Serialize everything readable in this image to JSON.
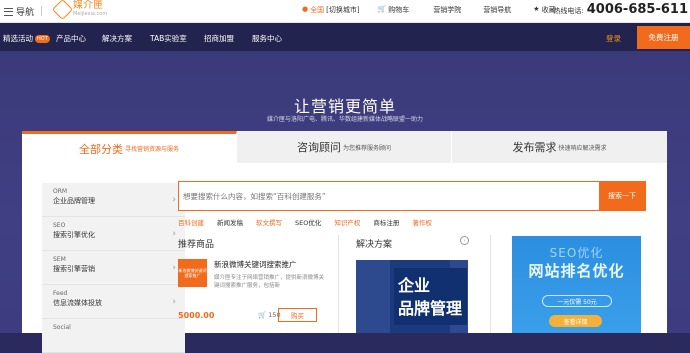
{
  "topbar": {
    "nav_label": "导航",
    "logo_text": "媒介匣",
    "logo_sub": "Meijiexia.com",
    "location": "全国",
    "switch_city": "[切换城市]",
    "cart": "购物车",
    "academy": "营销学院",
    "nav_guide": "营销导航",
    "favorite": "收藏",
    "hotline_label": "热线电话:",
    "hotline_number": "4006-685-611"
  },
  "mainnav": {
    "items": [
      "精选活动",
      "产品中心",
      "解决方案",
      "TAB实验室",
      "招商加盟",
      "服务中心"
    ],
    "hot_badge": "HOT",
    "login": "登录",
    "register": "免费注册"
  },
  "hero": {
    "title": "让营销更简单",
    "subtitle": "媒介匣与洛阳广电、腾讯、华数组建新媒体战略联盟一助力"
  },
  "tabs": [
    {
      "main": "全部分类",
      "sub": "寻找营销资源与服务"
    },
    {
      "main": "咨询顾问",
      "sub": "为您推荐服务顾问"
    },
    {
      "main": "发布需求",
      "sub": "快速响应解决需求"
    }
  ],
  "sidebar": {
    "items": [
      {
        "en": "ORM",
        "cn": "企业品牌管理"
      },
      {
        "en": "SEO",
        "cn": "搜索引擎优化"
      },
      {
        "en": "SEM",
        "cn": "搜索引擎营销"
      },
      {
        "en": "Feed",
        "cn": "信息流媒体投放"
      },
      {
        "en": "Social",
        "cn": ""
      }
    ],
    "arrow": "›"
  },
  "search": {
    "placeholder": "想要搜索什么内容，如搜索“百科创建服务”",
    "button": "搜索一下"
  },
  "tags": [
    {
      "label": "百科创建",
      "color": "#f26b1d"
    },
    {
      "label": "新闻发稿",
      "color": "#333333"
    },
    {
      "label": "软文撰写",
      "color": "#f26b1d"
    },
    {
      "label": "SEO优化",
      "color": "#333333"
    },
    {
      "label": "知识产权",
      "color": "#f26b1d"
    },
    {
      "label": "商标注册",
      "color": "#333333"
    },
    {
      "label": "著作权",
      "color": "#f26b1d"
    }
  ],
  "recommend": {
    "title": "推荐商品",
    "image_text": "新浪微博关键词搜索推广",
    "name": "新浪微博关键词搜索推广",
    "desc": "媒介匣专注于网络营销推广，提供新浪微博关键词搜索推广服务，包括新",
    "price": "5000.00",
    "sales": "150",
    "buy": "购买"
  },
  "solution": {
    "title": "解决方案",
    "line1": "企业",
    "line2": "品牌管理"
  },
  "ad": {
    "line1": "SEO优化",
    "line2": "网站排名优化",
    "offer": "一元仅需 50元",
    "detail": "查看详情"
  },
  "colors": {
    "accent": "#f26b1d",
    "nav_bg": "#23234f",
    "hero_bg": "#3b3a79"
  }
}
